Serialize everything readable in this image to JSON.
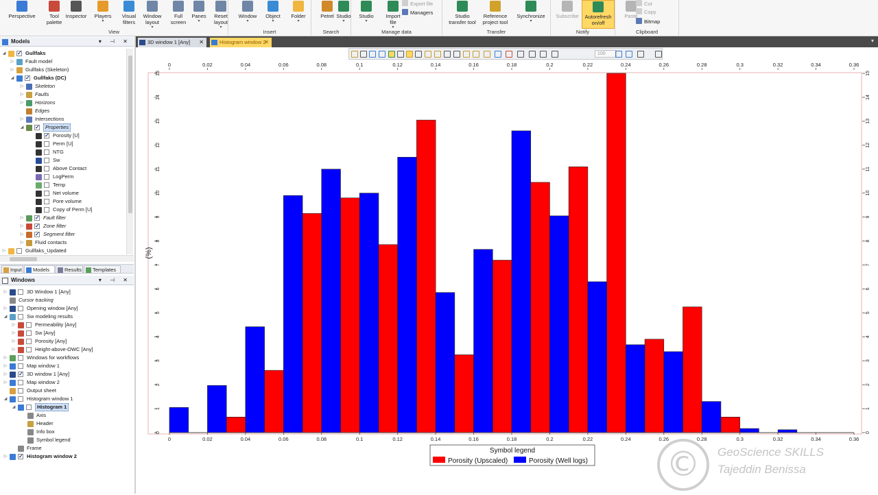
{
  "ribbon": {
    "groups": [
      {
        "label": "View",
        "buttons": [
          {
            "label": "Perspective",
            "icon": "perspective-icon",
            "color": "#3a7bd5"
          },
          {
            "label": "Tool\npalette",
            "icon": "tool-palette-icon",
            "color": "#c94a3b"
          },
          {
            "label": "Inspector",
            "icon": "inspector-icon",
            "color": "#555555"
          },
          {
            "label": "Players",
            "icon": "players-icon",
            "color": "#e69a2a"
          },
          {
            "label": "Visual\nfilters",
            "icon": "filter-icon",
            "color": "#3a8ad6"
          },
          {
            "label": "Window\nlayout",
            "icon": "window-layout-icon",
            "color": "#6f86a6"
          },
          {
            "label": "Full\nscreen",
            "icon": "fullscreen-icon",
            "color": "#6f86a6"
          },
          {
            "label": "Panes",
            "icon": "panes-icon",
            "color": "#6f86a6"
          },
          {
            "label": "Reset\nlayout",
            "icon": "reset-layout-icon",
            "color": "#6f86a6"
          }
        ]
      },
      {
        "label": "Insert",
        "buttons": [
          {
            "label": "Window",
            "icon": "window-icon",
            "color": "#6f86a6"
          },
          {
            "label": "Object",
            "icon": "object-icon",
            "color": "#3a8ad6"
          },
          {
            "label": "Folder",
            "icon": "folder-icon",
            "color": "#f0b640"
          }
        ]
      },
      {
        "label": "Search",
        "buttons": [
          {
            "label": "Petrel",
            "icon": "petrel-icon",
            "color": "#d08a2a"
          },
          {
            "label": "Studio",
            "icon": "studio-search-icon",
            "color": "#2e8b57"
          }
        ]
      },
      {
        "label": "Manage data",
        "buttons": [
          {
            "label": "Studio",
            "icon": "studio-icon",
            "color": "#2e8b57"
          },
          {
            "label": "Import\nfile",
            "icon": "import-icon",
            "color": "#2e8b57"
          }
        ],
        "small": [
          "Export file",
          "Managers"
        ]
      },
      {
        "label": "Transfer",
        "buttons": [
          {
            "label": "Studio\ntransfer tool",
            "icon": "transfer-tool-icon",
            "color": "#2e8b57"
          },
          {
            "label": "Reference\nproject tool",
            "icon": "reference-project-icon",
            "color": "#d0a22a"
          },
          {
            "label": "Synchronize",
            "icon": "synchronize-icon",
            "color": "#2e8b57"
          }
        ]
      },
      {
        "label": "Notify",
        "buttons": [
          {
            "label": "Subscribe",
            "icon": "subscribe-icon",
            "color": "#b5b5b5"
          },
          {
            "label": "Autorefresh\non/off",
            "icon": "autorefresh-icon",
            "color": "#2e8b57"
          }
        ]
      },
      {
        "label": "Clipboard",
        "buttons": [
          {
            "label": "Paste",
            "icon": "paste-icon",
            "color": "#b5b5b5"
          }
        ],
        "small": [
          "Cut",
          "Copy",
          "Bitmap"
        ]
      }
    ]
  },
  "models_panel": {
    "title": "Models",
    "items": [
      {
        "label": "Gullfaks",
        "exp": "▲",
        "cb": true,
        "icon": "folder-icon",
        "color": "#f0b640",
        "style": "bd"
      },
      {
        "label": "Fault model",
        "exp": "▷",
        "icon": "fault-model-icon",
        "color": "#5aa0c8"
      },
      {
        "label": "Gullfaks (Skeleton)",
        "exp": "▷",
        "icon": "grid-icon",
        "color": "#d8a040"
      },
      {
        "label": "Gullfaks (DC)",
        "exp": "▲",
        "cb": true,
        "icon": "grid-icon",
        "color": "#3a7bd5",
        "style": "bd"
      },
      {
        "label": "Skeleton",
        "exp": "▷",
        "icon": "skeleton-icon",
        "color": "#4a6fb5",
        "style": "it"
      },
      {
        "label": "Faults",
        "exp": "▷",
        "icon": "faults-icon",
        "color": "#c8a040",
        "style": "it"
      },
      {
        "label": "Horizons",
        "exp": "▷",
        "icon": "horizons-icon",
        "color": "#4a9a6a",
        "style": "it"
      },
      {
        "label": "Edges",
        "exp": "",
        "icon": "edges-icon",
        "color": "#c08030",
        "style": "it"
      },
      {
        "label": "Intersections",
        "exp": "▷",
        "icon": "intersections-icon",
        "color": "#5a7ab5",
        "style": "it"
      },
      {
        "label": "Properties",
        "exp": "▲",
        "cb": true,
        "icon": "properties-icon",
        "color": "#6a8a4a",
        "style": "it sel"
      },
      {
        "label": "Porosity [U]",
        "exp": "",
        "cb": true,
        "icon": "phi-icon",
        "color": "#333333"
      },
      {
        "label": "Perm [U]",
        "exp": "",
        "cb": false,
        "icon": "k-icon",
        "color": "#333333"
      },
      {
        "label": "NTG",
        "exp": "",
        "cb": false,
        "icon": "ntg-icon",
        "color": "#333333"
      },
      {
        "label": "Sw",
        "exp": "",
        "cb": false,
        "icon": "sw-icon",
        "color": "#2a4a9a"
      },
      {
        "label": "Above Contact",
        "exp": "",
        "cb": false,
        "icon": "above-contact-icon",
        "color": "#333333"
      },
      {
        "label": "LogPerm",
        "exp": "",
        "cb": false,
        "icon": "logperm-icon",
        "color": "#7a6ab5"
      },
      {
        "label": "Temp",
        "exp": "",
        "cb": false,
        "icon": "temp-icon",
        "color": "#6aaa6a"
      },
      {
        "label": "Net volume",
        "exp": "",
        "cb": false,
        "icon": "volume-icon",
        "color": "#333333"
      },
      {
        "label": "Pore volume",
        "exp": "",
        "cb": false,
        "icon": "volume-icon",
        "color": "#333333"
      },
      {
        "label": "Copy of Perm [U]",
        "exp": "",
        "cb": false,
        "icon": "k-icon",
        "color": "#333333"
      },
      {
        "label": "Fault filter",
        "exp": "▷",
        "cb": true,
        "icon": "fault-filter-icon",
        "color": "#5a9a5a",
        "style": "it"
      },
      {
        "label": "Zone filter",
        "exp": "▷",
        "cb": true,
        "icon": "zone-filter-icon",
        "color": "#c84a3a",
        "style": "it"
      },
      {
        "label": "Segment filter",
        "exp": "▷",
        "cb": true,
        "icon": "segment-filter-icon",
        "color": "#c86a2a",
        "style": "it"
      },
      {
        "label": "Fluid contacts",
        "exp": "▷",
        "icon": "fluid-contacts-icon",
        "color": "#c89a3a"
      },
      {
        "label": "Gullfaks_Updated",
        "exp": "▷",
        "cb": false,
        "icon": "folder-icon",
        "color": "#f0b640"
      }
    ]
  },
  "panel_tabs": [
    {
      "label": "Input",
      "color": "#d8a040"
    },
    {
      "label": "Models",
      "color": "#3a7bd5"
    },
    {
      "label": "Results",
      "color": "#7a7a9a"
    },
    {
      "label": "Templates",
      "color": "#5aa05a"
    }
  ],
  "windows_panel": {
    "title": "Windows",
    "items": [
      {
        "label": "3D Window 1 [Any]",
        "exp": "▷",
        "cb": false,
        "icon": "3d-window-icon",
        "color": "#2a4a8a",
        "x": 8
      },
      {
        "label": "Cursor tracking",
        "exp": "",
        "icon": "cursor-icon",
        "color": "#888888",
        "style": "it",
        "x": 8
      },
      {
        "label": "Opening window [Any]",
        "exp": "▷",
        "cb": false,
        "icon": "3d-window-icon",
        "color": "#2a4a8a",
        "x": 8
      },
      {
        "label": "Sw modeling results",
        "exp": "▲",
        "cb": false,
        "icon": "folder-icon",
        "color": "#5aa0c8",
        "x": 8
      },
      {
        "label": "Permeability [Any]",
        "exp": "▷",
        "cb": false,
        "icon": "histogram-window-icon",
        "color": "#c84a3a",
        "x": 20
      },
      {
        "label": "Sw [Any]",
        "exp": "▷",
        "cb": false,
        "icon": "histogram-window-icon",
        "color": "#c84a3a",
        "x": 20
      },
      {
        "label": "Porosity [Any]",
        "exp": "▷",
        "cb": false,
        "icon": "histogram-window-icon",
        "color": "#c84a3a",
        "x": 20
      },
      {
        "label": "Height-above-OWC [Any]",
        "exp": "▷",
        "cb": false,
        "icon": "histogram-window-icon",
        "color": "#c84a3a",
        "x": 20
      },
      {
        "label": "Windows for workflows",
        "exp": "▷",
        "cb": false,
        "icon": "folder-icon",
        "color": "#5aa05a",
        "x": 8
      },
      {
        "label": "Map window 1",
        "exp": "▷",
        "cb": false,
        "icon": "map-window-icon",
        "color": "#3a7bd5",
        "x": 8
      },
      {
        "label": "3D window 1 [Any]",
        "exp": "▷",
        "cb": true,
        "icon": "3d-window-icon",
        "color": "#2a4a8a",
        "x": 8
      },
      {
        "label": "Map window 2",
        "exp": "▷",
        "cb": false,
        "icon": "map-window-icon",
        "color": "#3a7bd5",
        "x": 8
      },
      {
        "label": "Output sheet",
        "exp": "",
        "cb": false,
        "icon": "output-sheet-icon",
        "color": "#d8a040",
        "x": 8
      },
      {
        "label": "Histogram window 1",
        "exp": "▲",
        "cb": false,
        "icon": "histogram-window-icon",
        "color": "#3a7bd5",
        "x": 8
      },
      {
        "label": "Histogram 1",
        "exp": "▲",
        "cb": false,
        "icon": "histogram-icon",
        "color": "#3a7bd5",
        "style": "bd sel",
        "x": 20
      },
      {
        "label": "Axis",
        "exp": "",
        "icon": "axis-icon",
        "color": "#888888",
        "x": 34
      },
      {
        "label": "Header",
        "exp": "",
        "icon": "header-icon",
        "color": "#c8a040",
        "x": 34
      },
      {
        "label": "Info box",
        "exp": "",
        "icon": "info-box-icon",
        "color": "#888888",
        "x": 34
      },
      {
        "label": "Symbol legend",
        "exp": "",
        "icon": "symbol-legend-icon",
        "color": "#888888",
        "x": 34
      },
      {
        "label": "Frame",
        "exp": "",
        "icon": "frame-icon",
        "color": "#888888",
        "x": 20
      },
      {
        "label": "Histogram window 2",
        "exp": "▷",
        "cb": true,
        "icon": "histogram-window-icon",
        "color": "#3a7bd5",
        "style": "bd",
        "x": 8
      }
    ]
  },
  "doc_tabs": [
    {
      "label": "3D window 1 [Any]",
      "active": false
    },
    {
      "label": "Histogram window 2",
      "active": true
    }
  ],
  "plot_toolbar": {
    "zoom_value": "100"
  },
  "chart_data": {
    "type": "bar",
    "x_tick_labels": [
      "0",
      "0.02",
      "0.04",
      "0.06",
      "0.08",
      "0.1",
      "0.12",
      "0.14",
      "0.16",
      "0.18",
      "0.2",
      "0.22",
      "0.24",
      "0.26",
      "0.28",
      "0.3",
      "0.32",
      "0.34",
      "0.36"
    ],
    "x_ticks": [
      0,
      0.02,
      0.04,
      0.06,
      0.08,
      0.1,
      0.12,
      0.14,
      0.16,
      0.18,
      0.2,
      0.22,
      0.24,
      0.26,
      0.28,
      0.3,
      0.32,
      0.34,
      0.36
    ],
    "xlim": [
      0,
      0.36
    ],
    "y_ticks": [
      0,
      1,
      2,
      3,
      4,
      5,
      6,
      7,
      8,
      9,
      10,
      11,
      12,
      13,
      14,
      15
    ],
    "ylim": [
      0,
      15
    ],
    "ylabel": "(%)",
    "bin_width": 0.02,
    "series": [
      {
        "name": "Porosity (Upscaled)",
        "color": "#ff0000",
        "offset": 1,
        "bins_start": [
          0,
          0.02,
          0.04,
          0.06,
          0.08,
          0.1,
          0.12,
          0.14,
          0.16,
          0.18,
          0.2,
          0.22,
          0.24,
          0.26,
          0.28,
          0.3,
          0.32,
          0.34
        ],
        "values": [
          0,
          0.65,
          2.6,
          9.15,
          9.8,
          7.85,
          13.05,
          3.25,
          7.2,
          10.45,
          11.1,
          15.0,
          3.9,
          5.25,
          0.65,
          0,
          0,
          0
        ]
      },
      {
        "name": "Porosity (Well logs)",
        "color": "#0000ff",
        "offset": 0,
        "bins_start": [
          0,
          0.02,
          0.04,
          0.06,
          0.08,
          0.1,
          0.12,
          0.14,
          0.16,
          0.18,
          0.2,
          0.22,
          0.24,
          0.26,
          0.28,
          0.3,
          0.32,
          0.34
        ],
        "values": [
          1.05,
          1.97,
          4.42,
          9.9,
          11.0,
          10.0,
          11.5,
          5.85,
          7.65,
          12.6,
          9.05,
          6.3,
          3.67,
          3.38,
          1.3,
          0.17,
          0.12,
          0
        ]
      }
    ],
    "legend_title": "Symbol legend",
    "legend_position": "bottom-center",
    "grid": false
  },
  "watermark": {
    "symbol": "©",
    "line1": "GeoScience SKILLS",
    "line2": "Tajeddin Benissa"
  }
}
